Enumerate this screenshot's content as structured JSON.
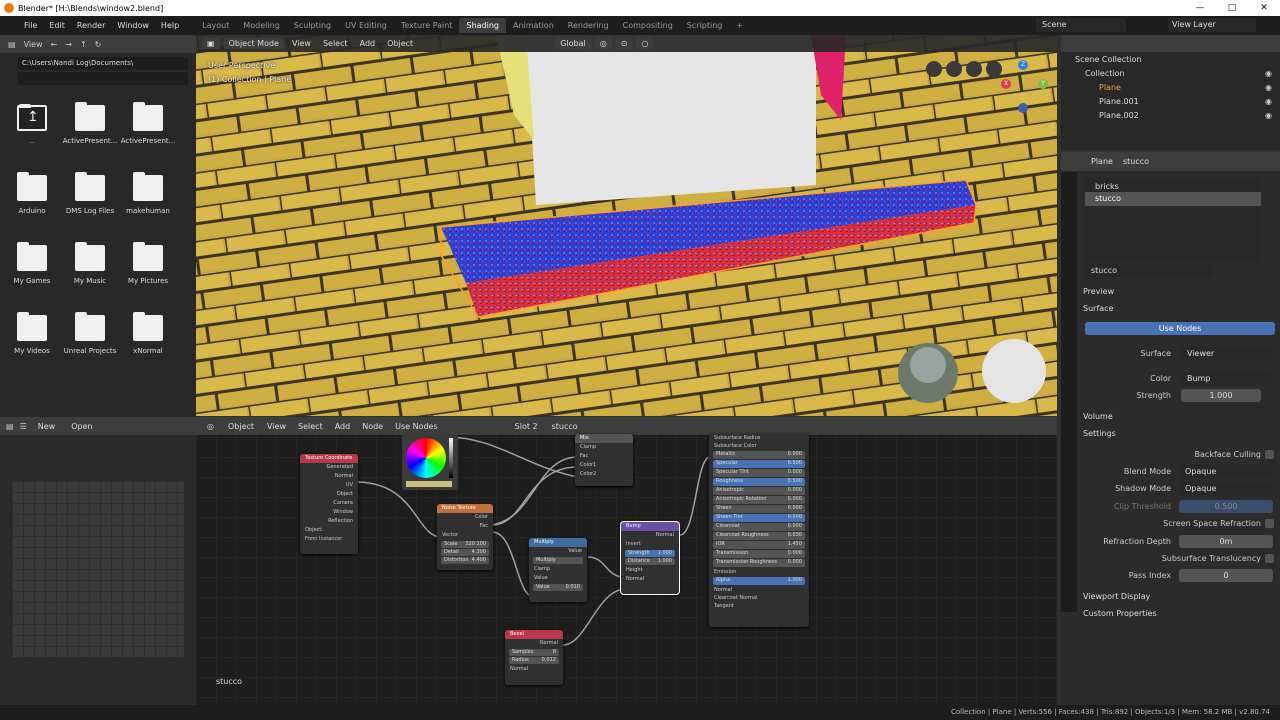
{
  "titlebar": {
    "title": "Blender* [H:\\Blends\\window2.blend]"
  },
  "menu": [
    "File",
    "Edit",
    "Render",
    "Window",
    "Help"
  ],
  "workspaces": [
    "Layout",
    "Modeling",
    "Sculpting",
    "UV Editing",
    "Texture Paint",
    "Shading",
    "Animation",
    "Rendering",
    "Compositing",
    "Scripting"
  ],
  "active_workspace": "Shading",
  "scene": "Scene",
  "view_layer": "View Layer",
  "filebrowser": {
    "view_label": "View",
    "path": "C:\\Users\\Nandi Log\\Documents\\",
    "items": [
      {
        "name": "..",
        "type": "parent"
      },
      {
        "name": "ActivePresent...",
        "type": "folder"
      },
      {
        "name": "ActivePresent...",
        "type": "folder"
      },
      {
        "name": "Arduino",
        "type": "folder"
      },
      {
        "name": "DMS Log Files",
        "type": "folder"
      },
      {
        "name": "makehuman",
        "type": "folder"
      },
      {
        "name": "My Games",
        "type": "folder"
      },
      {
        "name": "My Music",
        "type": "folder"
      },
      {
        "name": "My Pictures",
        "type": "folder"
      },
      {
        "name": "My Videos",
        "type": "folder"
      },
      {
        "name": "Unreal Projects",
        "type": "folder"
      },
      {
        "name": "xNormal",
        "type": "folder"
      }
    ]
  },
  "viewport": {
    "mode": "Object Mode",
    "menus": [
      "View",
      "Select",
      "Add",
      "Object"
    ],
    "orientation": "Global",
    "info_line1": "User Perspective",
    "info_line2": "(1) Collection | Plane",
    "gizmo": {
      "x_label": "X",
      "y_label": "Y",
      "z_label": "Z"
    }
  },
  "outliner": {
    "root": "Scene Collection",
    "items": [
      {
        "name": "Collection",
        "level": 1
      },
      {
        "name": "Plane",
        "level": 2,
        "active": true
      },
      {
        "name": "Plane.001",
        "level": 2
      },
      {
        "name": "Plane.002",
        "level": 2
      }
    ]
  },
  "properties": {
    "object": "Plane",
    "material": "stucco",
    "slots": [
      "bricks",
      "stucco"
    ],
    "material_name": "stucco",
    "preview_label": "Preview",
    "surface_label": "Surface",
    "use_nodes": "Use Nodes",
    "surface_field_label": "Surface",
    "surface_value": "Viewer",
    "color_label": "Color",
    "color_value": "Bump",
    "strength_label": "Strength",
    "strength_value": "1.000",
    "volume_label": "Volume",
    "settings_label": "Settings",
    "backface_culling": "Backface Culling",
    "blend_mode_label": "Blend Mode",
    "blend_mode": "Opaque",
    "shadow_mode_label": "Shadow Mode",
    "shadow_mode": "Opaque",
    "clip_threshold_label": "Clip Threshold",
    "clip_threshold": "0.500",
    "ssr_label": "Screen Space Refraction",
    "refraction_depth_label": "Refraction Depth",
    "refraction_depth": "0m",
    "subsurface_translucency": "Subsurface Translucency",
    "pass_index_label": "Pass Index",
    "pass_index": "0",
    "viewport_display": "Viewport Display",
    "custom_properties": "Custom Properties"
  },
  "imgeditor": {
    "new": "New",
    "open": "Open",
    "material_label": "stucco"
  },
  "nodeeditor": {
    "object": "Object",
    "menus": [
      "View",
      "Select",
      "Add",
      "Node"
    ],
    "use_nodes": "Use Nodes",
    "slot": "Slot 2",
    "material": "stucco",
    "nodes": {
      "texcoord": {
        "title": "Texture Coordinate",
        "outputs": [
          "Generated",
          "Normal",
          "UV",
          "Object",
          "Camera",
          "Window",
          "Reflection"
        ],
        "object_label": "Object:",
        "from_instancer": "From Instancer"
      },
      "noise": {
        "title": "Noise Texture",
        "outputs": [
          "Color",
          "Fac"
        ],
        "vector": "Vector",
        "fields": [
          [
            "Scale",
            "320.100"
          ],
          [
            "Detail",
            "4.300"
          ],
          [
            "Distortion",
            "4.400"
          ]
        ]
      },
      "multiply": {
        "title": "Multiply",
        "output": "Value",
        "op": "Multiply",
        "clamp": "Clamp",
        "value_label": "Value",
        "value": [
          "Value",
          "0.010"
        ]
      },
      "bump": {
        "title": "Bump",
        "output": "Normal",
        "invert": "Invert",
        "fields": [
          [
            "Strength",
            "1.000"
          ],
          [
            "Distance",
            "1.000"
          ]
        ],
        "inputs": [
          "Height",
          "Normal"
        ]
      },
      "bevel": {
        "title": "Bevel",
        "output": "Normal",
        "fields": [
          [
            "Samples",
            "8"
          ],
          [
            "Radius",
            "0.012"
          ]
        ],
        "inputs": [
          "Normal"
        ]
      },
      "mix": {
        "title": "Mix",
        "clamp": "Clamp",
        "inputs": [
          "Fac",
          "Color1",
          "Color2"
        ]
      },
      "bsdf": {
        "rows": [
          [
            "Subsurface Radius",
            ""
          ],
          [
            "Subsurface Color",
            ""
          ],
          [
            "Metallic",
            "0.000"
          ],
          [
            "Specular",
            "0.500"
          ],
          [
            "Specular Tint",
            "0.000"
          ],
          [
            "Roughness",
            "0.500"
          ],
          [
            "Anisotropic",
            "0.000"
          ],
          [
            "Anisotropic Rotation",
            "0.000"
          ],
          [
            "Sheen",
            "0.000"
          ],
          [
            "Sheen Tint",
            "0.500"
          ],
          [
            "Clearcoat",
            "0.000"
          ],
          [
            "Clearcoat Roughness",
            "0.030"
          ],
          [
            "IOR",
            "1.450"
          ],
          [
            "Transmission",
            "0.000"
          ],
          [
            "Transmission Roughness",
            "0.000"
          ],
          [
            "Emission",
            ""
          ],
          [
            "Alpha",
            "1.000"
          ],
          [
            "Normal",
            ""
          ],
          [
            "Clearcoat Normal",
            ""
          ],
          [
            "Tangent",
            ""
          ]
        ]
      }
    }
  },
  "statusbar": "Collection | Plane | Verts:556 | Faces:438 | Tris:892 | Objects:1/3 | Mem: 58.2 MB | v2.80.74",
  "colors": {
    "accent": "#4772b3",
    "active_orange": "#e87d0d",
    "bg": "#303030"
  }
}
